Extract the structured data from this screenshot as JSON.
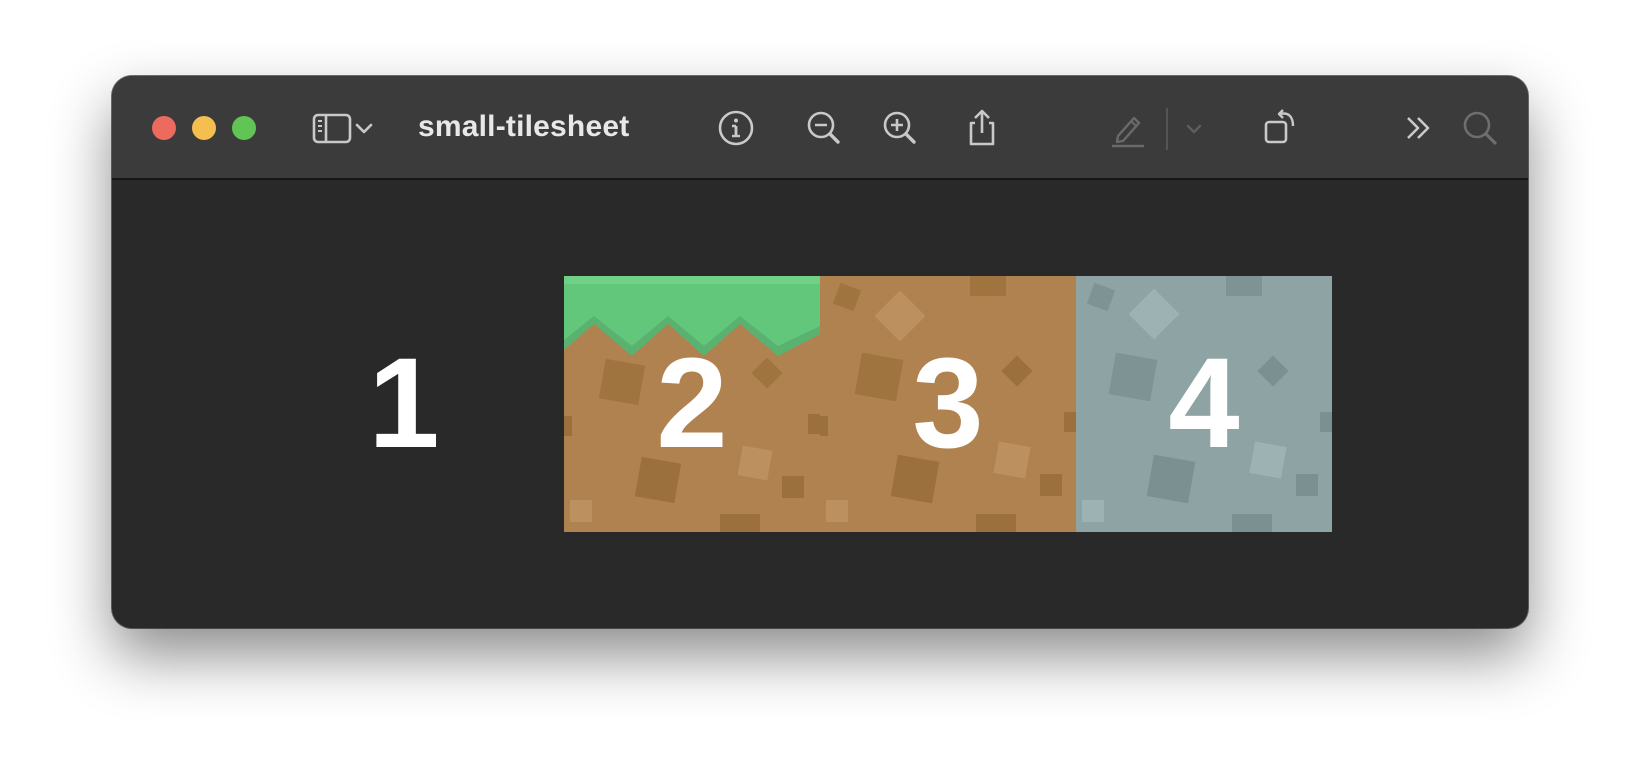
{
  "window": {
    "title": "small-tilesheet"
  },
  "toolbar": {
    "icons": [
      "sidebar-toggle-icon",
      "chevron-down-icon",
      "info-icon",
      "zoom-out-icon",
      "zoom-in-icon",
      "share-icon",
      "markup-pen-icon",
      "chevron-down-icon",
      "rotate-icon",
      "more-chevrons-icon",
      "search-icon"
    ]
  },
  "tiles": [
    {
      "label": "1",
      "kind": "empty"
    },
    {
      "label": "2",
      "kind": "grass-dirt"
    },
    {
      "label": "3",
      "kind": "dirt"
    },
    {
      "label": "4",
      "kind": "stone"
    }
  ],
  "colors": {
    "close": "#ec6a5e",
    "minimize": "#f4bf4f",
    "maximize": "#61c454",
    "grass": "#63c77b",
    "dirt": "#b0824f",
    "stone": "#8ea3a4"
  }
}
